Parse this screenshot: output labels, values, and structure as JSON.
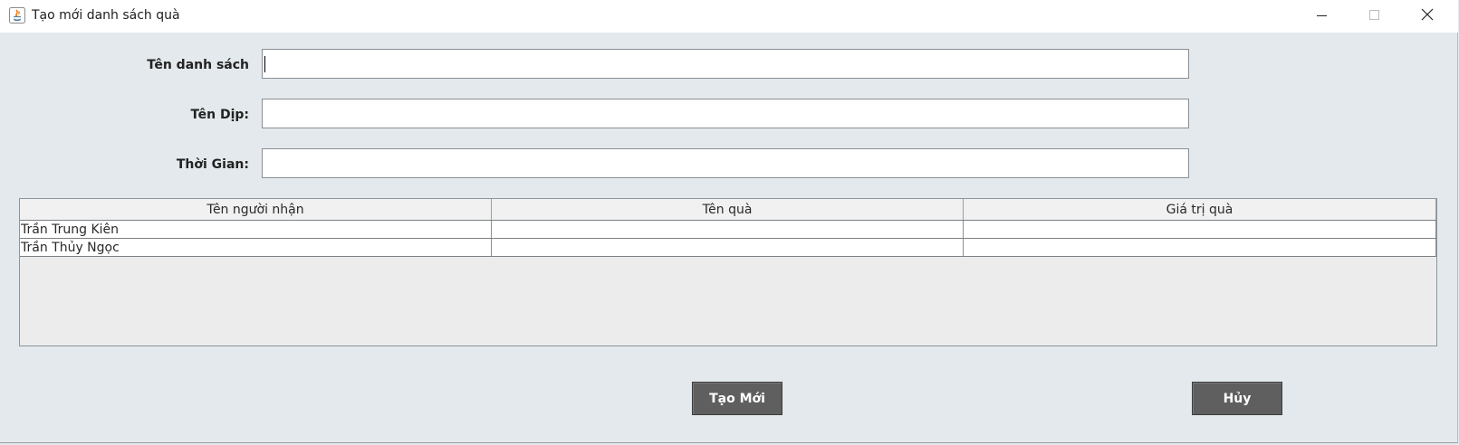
{
  "window": {
    "title": "Tạo mới danh sách quà",
    "app_icon": "java-icon",
    "controls": [
      "minimize-icon",
      "maximize-icon",
      "close-icon"
    ]
  },
  "form": {
    "list_name_label": "Tên danh sách",
    "list_name_value": "",
    "occasion_label": "Tên Dịp:",
    "occasion_value": "",
    "time_label": "Thời Gian:",
    "time_value": ""
  },
  "table": {
    "columns": [
      "Tên người nhận",
      "Tên quà",
      "Giá trị quà"
    ],
    "rows": [
      [
        "Trần Trung Kiên",
        "",
        ""
      ],
      [
        "Trần Thủy Ngọc",
        "",
        ""
      ]
    ]
  },
  "buttons": {
    "create_label": "Tạo Mới",
    "cancel_label": "Hủy"
  },
  "colors": {
    "background": "#e3e9ec",
    "button": "#5f5f5f",
    "button_text": "#ffffff"
  }
}
